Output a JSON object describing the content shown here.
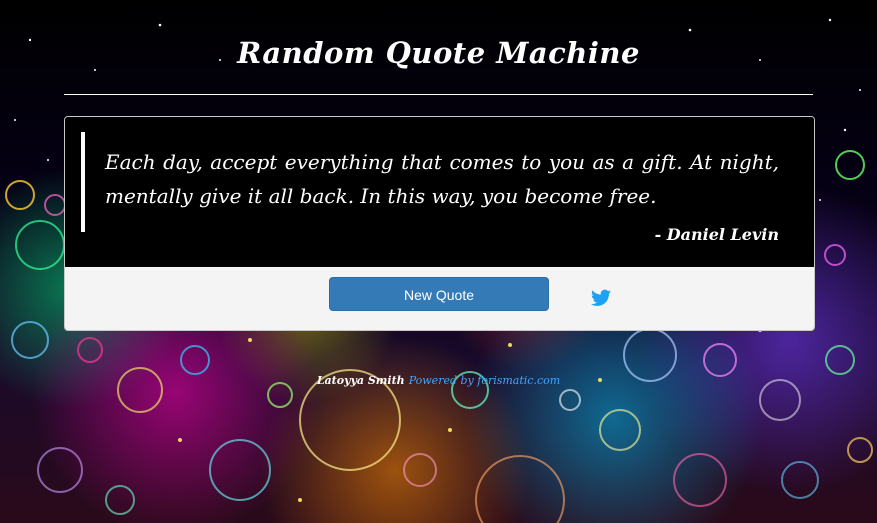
{
  "page": {
    "title": "Random Quote Machine"
  },
  "quote": {
    "text": "Each day, accept everything that comes to you as a gift. At night, mentally give it all back. In this way, you become free.",
    "author": "- Daniel Levin"
  },
  "actions": {
    "new_quote_label": "New Quote",
    "tweet_icon": "twitter-icon"
  },
  "footer": {
    "author": "Latoyya Smith",
    "powered_by": "Powered by forismatic.com"
  },
  "colors": {
    "button": "#337ab7",
    "twitter": "#1da1f2",
    "link": "#3fa6ff",
    "card_bottom": "#f4f4f4"
  }
}
